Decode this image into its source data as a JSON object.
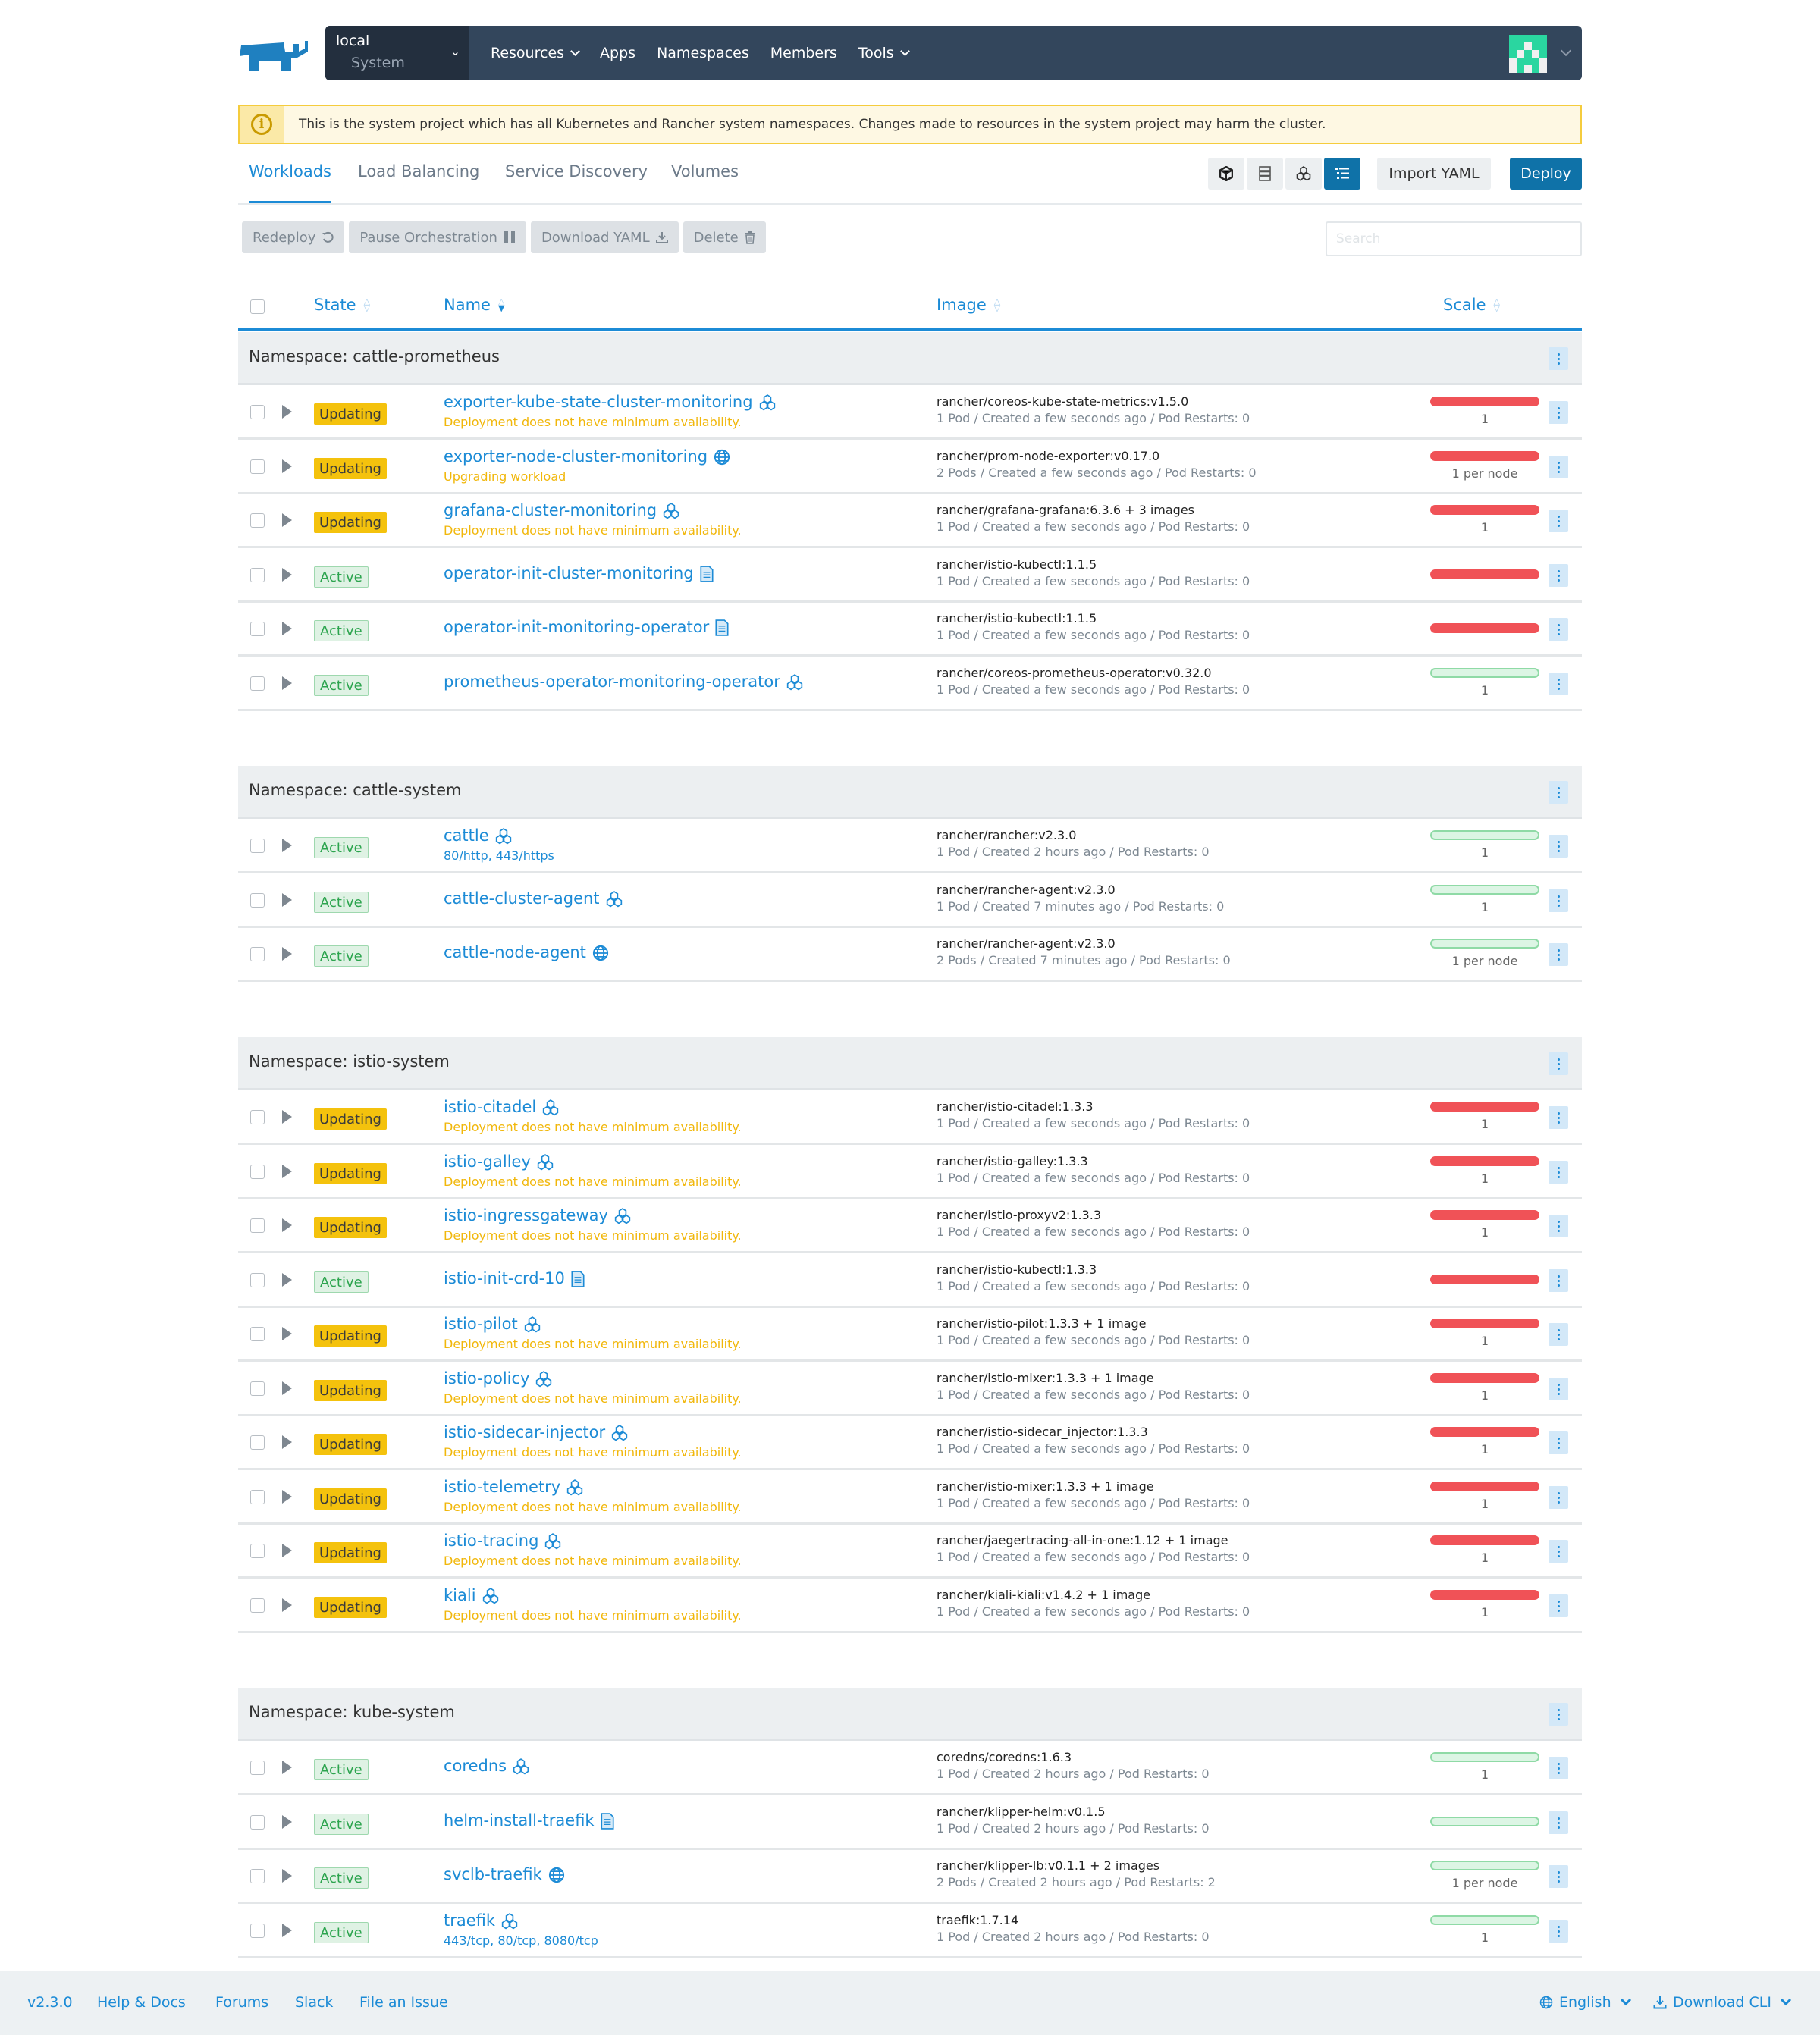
{
  "header": {
    "cluster": "local",
    "project": "System",
    "nav": [
      {
        "label": "Resources",
        "dropdown": true
      },
      {
        "label": "Apps",
        "dropdown": false
      },
      {
        "label": "Namespaces",
        "dropdown": false
      },
      {
        "label": "Members",
        "dropdown": false
      },
      {
        "label": "Tools",
        "dropdown": true
      }
    ]
  },
  "banner": {
    "icon": "info-icon",
    "text": "This is the system project which has all Kubernetes and Rancher system namespaces. Changes made to resources in the system project may harm the cluster."
  },
  "tabs": [
    {
      "label": "Workloads",
      "active": true
    },
    {
      "label": "Load Balancing",
      "active": false
    },
    {
      "label": "Service Discovery",
      "active": false
    },
    {
      "label": "Volumes",
      "active": false
    }
  ],
  "view_modes": [
    {
      "icon": "cube-icon",
      "active": false
    },
    {
      "icon": "node-icon",
      "active": false
    },
    {
      "icon": "workload-icon",
      "active": false
    },
    {
      "icon": "list-icon",
      "active": true
    }
  ],
  "actions": {
    "import_yaml": "Import YAML",
    "deploy": "Deploy"
  },
  "bulk_actions": [
    {
      "label": "Redeploy",
      "icon": "redeploy-icon"
    },
    {
      "label": "Pause Orchestration",
      "icon": "pause-icon"
    },
    {
      "label": "Download YAML",
      "icon": "download-icon"
    },
    {
      "label": "Delete",
      "icon": "trash-icon"
    }
  ],
  "search": {
    "placeholder": "Search",
    "value": ""
  },
  "columns": {
    "state": "State",
    "name": "Name",
    "image": "Image",
    "scale": "Scale"
  },
  "groups": [
    {
      "title": "Namespace: cattle-prometheus",
      "rows": [
        {
          "state": "Updating",
          "name": "exporter-kube-state-cluster-monitoring",
          "icon": "deployment-icon",
          "sub": "Deployment does not have minimum availability.",
          "sub_type": "warn",
          "image": "rancher/coreos-kube-state-metrics:v1.5.0",
          "meta": "1 Pod / Created a few seconds ago / Pod Restarts: 0",
          "scale_health": "red",
          "scale": "1"
        },
        {
          "state": "Updating",
          "name": "exporter-node-cluster-monitoring",
          "icon": "daemonset-icon",
          "sub": "Upgrading workload",
          "sub_type": "warn",
          "image": "rancher/prom-node-exporter:v0.17.0",
          "meta": "2 Pods / Created a few seconds ago / Pod Restarts: 0",
          "scale_health": "red",
          "scale": "1 per node"
        },
        {
          "state": "Updating",
          "name": "grafana-cluster-monitoring",
          "icon": "deployment-icon",
          "sub": "Deployment does not have minimum availability.",
          "sub_type": "warn",
          "image": "rancher/grafana-grafana:6.3.6 + 3 images",
          "meta": "1 Pod / Created a few seconds ago / Pod Restarts: 0",
          "scale_health": "red",
          "scale": "1"
        },
        {
          "state": "Active",
          "name": "operator-init-cluster-monitoring",
          "icon": "job-icon",
          "sub": "",
          "sub_type": "",
          "image": "rancher/istio-kubectl:1.1.5",
          "meta": "1 Pod / Created a few seconds ago / Pod Restarts: 0",
          "scale_health": "red",
          "scale": ""
        },
        {
          "state": "Active",
          "name": "operator-init-monitoring-operator",
          "icon": "job-icon",
          "sub": "",
          "sub_type": "",
          "image": "rancher/istio-kubectl:1.1.5",
          "meta": "1 Pod / Created a few seconds ago / Pod Restarts: 0",
          "scale_health": "red",
          "scale": ""
        },
        {
          "state": "Active",
          "name": "prometheus-operator-monitoring-operator",
          "icon": "deployment-icon",
          "sub": "",
          "sub_type": "",
          "image": "rancher/coreos-prometheus-operator:v0.32.0",
          "meta": "1 Pod / Created a few seconds ago / Pod Restarts: 0",
          "scale_health": "green",
          "scale": "1"
        }
      ]
    },
    {
      "title": "Namespace: cattle-system",
      "rows": [
        {
          "state": "Active",
          "name": "cattle",
          "icon": "deployment-icon",
          "sub": "80/http, 443/https",
          "sub_type": "ports",
          "image": "rancher/rancher:v2.3.0",
          "meta": "1 Pod / Created 2 hours ago / Pod Restarts: 0",
          "scale_health": "green",
          "scale": "1"
        },
        {
          "state": "Active",
          "name": "cattle-cluster-agent",
          "icon": "deployment-icon",
          "sub": "",
          "sub_type": "",
          "image": "rancher/rancher-agent:v2.3.0",
          "meta": "1 Pod / Created 7 minutes ago / Pod Restarts: 0",
          "scale_health": "green",
          "scale": "1"
        },
        {
          "state": "Active",
          "name": "cattle-node-agent",
          "icon": "daemonset-icon",
          "sub": "",
          "sub_type": "",
          "image": "rancher/rancher-agent:v2.3.0",
          "meta": "2 Pods / Created 7 minutes ago / Pod Restarts: 0",
          "scale_health": "green",
          "scale": "1 per node"
        }
      ]
    },
    {
      "title": "Namespace: istio-system",
      "rows": [
        {
          "state": "Updating",
          "name": "istio-citadel",
          "icon": "deployment-icon",
          "sub": "Deployment does not have minimum availability.",
          "sub_type": "warn",
          "image": "rancher/istio-citadel:1.3.3",
          "meta": "1 Pod / Created a few seconds ago / Pod Restarts: 0",
          "scale_health": "red",
          "scale": "1"
        },
        {
          "state": "Updating",
          "name": "istio-galley",
          "icon": "deployment-icon",
          "sub": "Deployment does not have minimum availability.",
          "sub_type": "warn",
          "image": "rancher/istio-galley:1.3.3",
          "meta": "1 Pod / Created a few seconds ago / Pod Restarts: 0",
          "scale_health": "red",
          "scale": "1"
        },
        {
          "state": "Updating",
          "name": "istio-ingressgateway",
          "icon": "deployment-icon",
          "sub": "Deployment does not have minimum availability.",
          "sub_type": "warn",
          "image": "rancher/istio-proxyv2:1.3.3",
          "meta": "1 Pod / Created a few seconds ago / Pod Restarts: 0",
          "scale_health": "red",
          "scale": "1"
        },
        {
          "state": "Active",
          "name": "istio-init-crd-10",
          "icon": "job-icon",
          "sub": "",
          "sub_type": "",
          "image": "rancher/istio-kubectl:1.3.3",
          "meta": "1 Pod / Created a few seconds ago / Pod Restarts: 0",
          "scale_health": "red",
          "scale": ""
        },
        {
          "state": "Updating",
          "name": "istio-pilot",
          "icon": "deployment-icon",
          "sub": "Deployment does not have minimum availability.",
          "sub_type": "warn",
          "image": "rancher/istio-pilot:1.3.3 + 1 image",
          "meta": "1 Pod / Created a few seconds ago / Pod Restarts: 0",
          "scale_health": "red",
          "scale": "1"
        },
        {
          "state": "Updating",
          "name": "istio-policy",
          "icon": "deployment-icon",
          "sub": "Deployment does not have minimum availability.",
          "sub_type": "warn",
          "image": "rancher/istio-mixer:1.3.3 + 1 image",
          "meta": "1 Pod / Created a few seconds ago / Pod Restarts: 0",
          "scale_health": "red",
          "scale": "1"
        },
        {
          "state": "Updating",
          "name": "istio-sidecar-injector",
          "icon": "deployment-icon",
          "sub": "Deployment does not have minimum availability.",
          "sub_type": "warn",
          "image": "rancher/istio-sidecar_injector:1.3.3",
          "meta": "1 Pod / Created a few seconds ago / Pod Restarts: 0",
          "scale_health": "red",
          "scale": "1"
        },
        {
          "state": "Updating",
          "name": "istio-telemetry",
          "icon": "deployment-icon",
          "sub": "Deployment does not have minimum availability.",
          "sub_type": "warn",
          "image": "rancher/istio-mixer:1.3.3 + 1 image",
          "meta": "1 Pod / Created a few seconds ago / Pod Restarts: 0",
          "scale_health": "red",
          "scale": "1"
        },
        {
          "state": "Updating",
          "name": "istio-tracing",
          "icon": "deployment-icon",
          "sub": "Deployment does not have minimum availability.",
          "sub_type": "warn",
          "image": "rancher/jaegertracing-all-in-one:1.12 + 1 image",
          "meta": "1 Pod / Created a few seconds ago / Pod Restarts: 0",
          "scale_health": "red",
          "scale": "1"
        },
        {
          "state": "Updating",
          "name": "kiali",
          "icon": "deployment-icon",
          "sub": "Deployment does not have minimum availability.",
          "sub_type": "warn",
          "image": "rancher/kiali-kiali:v1.4.2 + 1 image",
          "meta": "1 Pod / Created a few seconds ago / Pod Restarts: 0",
          "scale_health": "red",
          "scale": "1"
        }
      ]
    },
    {
      "title": "Namespace: kube-system",
      "rows": [
        {
          "state": "Active",
          "name": "coredns",
          "icon": "deployment-icon",
          "sub": "",
          "sub_type": "",
          "image": "coredns/coredns:1.6.3",
          "meta": "1 Pod / Created 2 hours ago / Pod Restarts: 0",
          "scale_health": "green",
          "scale": "1"
        },
        {
          "state": "Active",
          "name": "helm-install-traefik",
          "icon": "job-icon",
          "sub": "",
          "sub_type": "",
          "image": "rancher/klipper-helm:v0.1.5",
          "meta": "1 Pod / Created 2 hours ago / Pod Restarts: 0",
          "scale_health": "green",
          "scale": ""
        },
        {
          "state": "Active",
          "name": "svclb-traefik",
          "icon": "daemonset-icon",
          "sub": "",
          "sub_type": "",
          "image": "rancher/klipper-lb:v0.1.1 + 2 images",
          "meta": "2 Pods / Created 2 hours ago / Pod Restarts: 2",
          "scale_health": "green",
          "scale": "1 per node"
        },
        {
          "state": "Active",
          "name": "traefik",
          "icon": "deployment-icon",
          "sub": "443/tcp, 80/tcp, 8080/tcp",
          "sub_type": "ports",
          "image": "traefik:1.7.14",
          "meta": "1 Pod / Created 2 hours ago / Pod Restarts: 0",
          "scale_health": "green",
          "scale": "1"
        }
      ]
    }
  ],
  "footer": {
    "version": "v2.3.0",
    "links": [
      "Help & Docs",
      "Forums",
      "Slack",
      "File an Issue"
    ],
    "language": "English",
    "download_cli": "Download CLI"
  },
  "colors": {
    "accent": "#1c8bd6",
    "nav_bg": "#33465c",
    "primary_button": "#0f72a8",
    "updating": "#f4c20d",
    "active": "#2ca44e",
    "scale_unhealthy": "#f05257",
    "scale_healthy": "#dcf5e4"
  }
}
